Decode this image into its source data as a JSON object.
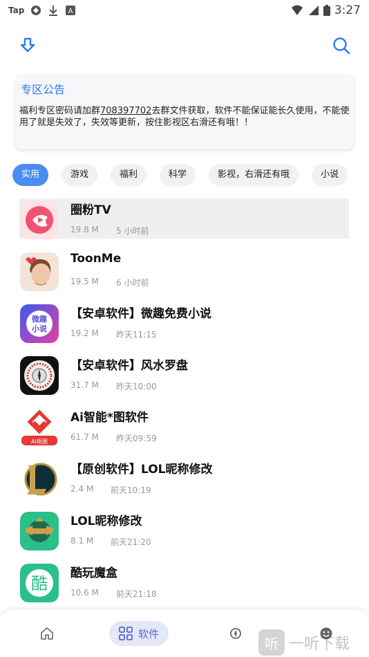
{
  "statusbar": {
    "left_text": "Tap",
    "time": "3:27"
  },
  "toolbar": {
    "download_icon": "download-arrow-icon",
    "search_icon": "search-icon"
  },
  "notice": {
    "title": "专区公告",
    "body_before": "福利专区密码请加群",
    "group_number": "708397702",
    "body_after": "去群文件获取，软件不能保证能长久使用，不能使用了就是失效了，失效等更新，按住影视区右滑还有哦！！"
  },
  "chips": [
    "实用",
    "游戏",
    "福利",
    "科学",
    "影视，右滑还有哦",
    "小说"
  ],
  "apps": [
    {
      "name": "圈粉TV",
      "size": "19.8 M",
      "time": "5 小时前"
    },
    {
      "name": "ToonMe",
      "size": "19.5 M",
      "time": "6 小时前"
    },
    {
      "name": "【安卓软件】微趣免费小说",
      "size": "19.2 M",
      "time": "昨天11:15",
      "icon_text": "微趣\n小说"
    },
    {
      "name": "【安卓软件】风水罗盘",
      "size": "31.7 M",
      "time": "昨天10:00"
    },
    {
      "name": "Ai智能*图软件",
      "size": "61.7 M",
      "time": "昨天09:59",
      "icon_text": "AI抠图"
    },
    {
      "name": "【原创软件】LOL昵称修改",
      "size": "2.4 M",
      "time": "前天10:19"
    },
    {
      "name": "LOL昵称修改",
      "size": "8.1 M",
      "time": "前天21:20"
    },
    {
      "name": "酷玩魔盒",
      "size": "10.6 M",
      "time": "前天21:18",
      "icon_text": "酷"
    }
  ],
  "bottomnav": {
    "active_label": "软件"
  },
  "watermark": {
    "box": "听",
    "text": "一听下载"
  },
  "colors": {
    "accent": "#4a8cf0",
    "title_blue": "#2d7cf0",
    "nav_active_bg": "#e4e8f8",
    "nav_active_text": "#5a67c8"
  }
}
